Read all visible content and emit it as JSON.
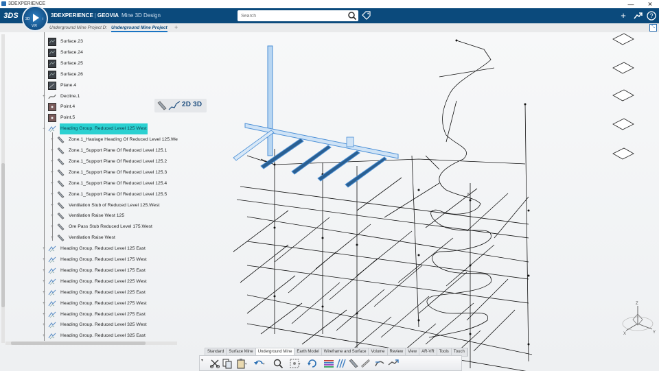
{
  "os": {
    "title": "3DEXPERIENCE",
    "minimize": "—",
    "close": "✕"
  },
  "header": {
    "brand_logo": "3DS",
    "compass_version": "V.R",
    "compass_quadrants": [
      "3D",
      "i"
    ],
    "app_name_prefix": "3DEXPERIENCE",
    "separator": "|",
    "brand_name": "GEOVIA",
    "app_name": "Mine 3D Design",
    "search_placeholder": "Search",
    "icons": [
      "search-icon",
      "tag-icon",
      "add-icon",
      "share-icon",
      "help-icon"
    ]
  },
  "tabs": {
    "items": [
      {
        "label": "Underground Mine Project D:",
        "active": false
      },
      {
        "label": "Underground Mine Project",
        "active": true
      }
    ],
    "add": "+"
  },
  "tree": {
    "items": [
      {
        "label": "Surface.23",
        "icon": "surface-icon",
        "level": 1
      },
      {
        "label": "Surface.24",
        "icon": "surface-icon",
        "level": 1
      },
      {
        "label": "Surface.25",
        "icon": "surface-icon",
        "level": 1
      },
      {
        "label": "Surface.26",
        "icon": "surface-icon",
        "level": 1
      },
      {
        "label": "Plane.4",
        "icon": "plane-icon",
        "level": 1
      },
      {
        "label": "Decline.1",
        "icon": "decline-icon",
        "level": 1,
        "toggle": "+"
      },
      {
        "label": "Point.4",
        "icon": "point-icon",
        "level": 1
      },
      {
        "label": "Point.5",
        "icon": "point-icon",
        "level": 1
      },
      {
        "label": "Heading Group. Reduced Level 125 West",
        "icon": "heading-group-icon",
        "level": 1,
        "toggle": "−",
        "highlighted": true
      },
      {
        "label": "Zone.1_Haulage Heading Of Reduced Level 125.We",
        "icon": "heading-icon",
        "level": 2,
        "toggle": "+"
      },
      {
        "label": "Zone.1_Support Plane Of Reduced Level 125.1",
        "icon": "heading-icon",
        "level": 2,
        "toggle": "+"
      },
      {
        "label": "Zone.1_Support Plane Of Reduced Level 125.2",
        "icon": "heading-icon",
        "level": 2,
        "toggle": "+"
      },
      {
        "label": "Zone.1_Support Plane Of Reduced Level 125.3",
        "icon": "heading-icon",
        "level": 2,
        "toggle": "+"
      },
      {
        "label": "Zone.1_Support Plane Of Reduced Level 125.4",
        "icon": "heading-icon",
        "level": 2,
        "toggle": "+"
      },
      {
        "label": "Zone.1_Support Plane Of Reduced Level 125.5",
        "icon": "heading-icon",
        "level": 2,
        "toggle": "+"
      },
      {
        "label": "Ventilation Stub of Reduced Level 125.West",
        "icon": "heading-icon",
        "level": 2,
        "toggle": "+"
      },
      {
        "label": "Ventilation Raise West 125",
        "icon": "heading-icon",
        "level": 2,
        "toggle": "+"
      },
      {
        "label": "Ore Pass Stub Reduced Level 175.West",
        "icon": "heading-icon",
        "level": 2,
        "toggle": "+"
      },
      {
        "label": "Ventilation Raise West",
        "icon": "heading-icon",
        "level": 2,
        "toggle": "+"
      },
      {
        "label": "Heading Group. Reduced Level 125 East",
        "icon": "heading-group-icon",
        "level": 1,
        "toggle": "+"
      },
      {
        "label": "Heading Group. Reduced Level 175 West",
        "icon": "heading-group-icon",
        "level": 1,
        "toggle": "+"
      },
      {
        "label": "Heading Group. Reduced Level 175 East",
        "icon": "heading-group-icon",
        "level": 1,
        "toggle": "+"
      },
      {
        "label": "Heading Group. Reduced Level 225 West",
        "icon": "heading-group-icon",
        "level": 1,
        "toggle": "+"
      },
      {
        "label": "Heading Group. Reduced Level 225 East",
        "icon": "heading-group-icon",
        "level": 1,
        "toggle": "+"
      },
      {
        "label": "Heading Group. Reduced Level 275 West",
        "icon": "heading-group-icon",
        "level": 1,
        "toggle": "+"
      },
      {
        "label": "Heading Group. Reduced Level 275 East",
        "icon": "heading-group-icon",
        "level": 1,
        "toggle": "+"
      },
      {
        "label": "Heading Group. Reduced Level 325 West",
        "icon": "heading-group-icon",
        "level": 1,
        "toggle": "+"
      },
      {
        "label": "Heading Group. Reduced Level 325 East",
        "icon": "heading-group-icon",
        "level": 1,
        "toggle": "+"
      }
    ]
  },
  "dim_toolbar": {
    "label": "2D 3D",
    "icons": [
      "heading-tool-icon",
      "polyline-icon"
    ]
  },
  "action_bar": {
    "tabs": [
      {
        "label": "Standard",
        "active": false
      },
      {
        "label": "Surface Mine",
        "active": false
      },
      {
        "label": "Underground Mine",
        "active": true
      },
      {
        "label": "Earth Model",
        "active": false
      },
      {
        "label": "Wireframe and Surface",
        "active": false
      },
      {
        "label": "Volume",
        "active": false
      },
      {
        "label": "Review",
        "active": false
      },
      {
        "label": "View",
        "active": false
      },
      {
        "label": "AR-VR",
        "active": false
      },
      {
        "label": "Tools",
        "active": false
      },
      {
        "label": "Touch",
        "active": false
      }
    ],
    "tools": [
      "cut-icon",
      "copy-icon",
      "paste-icon",
      "undo-icon",
      "zoom-icon",
      "select-icon",
      "rotate-icon",
      "headings-icon",
      "multi-heading-icon",
      "heading-icon",
      "pipe-icon",
      "ramp-icon",
      "decline-tool-icon"
    ],
    "collapse": "▾"
  },
  "compass_axes": {
    "z": "Z",
    "x": "X",
    "y": "Y"
  },
  "colors": {
    "header": "#0b4a7c",
    "highlight": "#2bd1d1",
    "selection": "#4a8fd6",
    "wire": "#111111"
  }
}
